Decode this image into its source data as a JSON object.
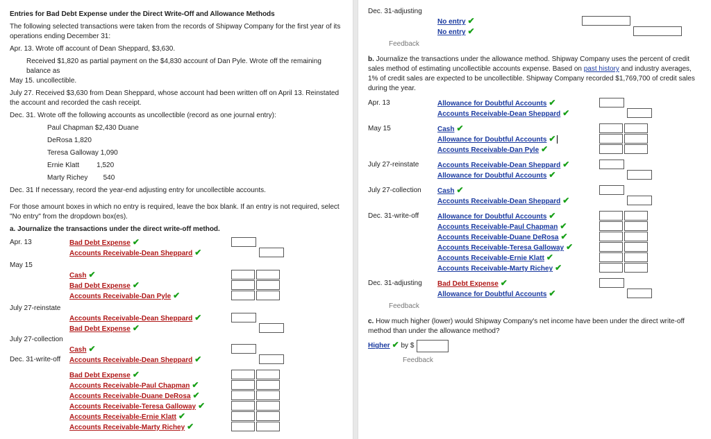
{
  "heading": "Entries for Bad Debt Expense under the Direct Write-Off and Allowance Methods",
  "intro": "The following selected transactions were taken from the records of Shipway Company for the first year of its operations ending December 31:",
  "tx": {
    "apr13": "Apr. 13. Wrote off account of Dean Sheppard, $3,630.",
    "may15a": "Received $1,820 as partial payment on the $4,830 account of Dan Pyle. Wrote off the remaining balance as",
    "may15b": "May 15. uncollectible.",
    "jul27": "July 27. Received $3,630 from Dean Sheppard, whose account had been written off on April 13. Reinstated the account and recorded the cash receipt.",
    "dec31": "Dec. 31. Wrote off the following accounts as uncollectible (record as one journal entry):",
    "list": {
      "a": "Paul Chapman $2,430 Duane",
      "b": "DeRosa 1,820",
      "c": "Teresa Galloway 1,090",
      "d": "Ernie Klatt         1,520",
      "e": "Marty Richey        540"
    },
    "dec31b": "Dec. 31 If necessary, record the year-end adjusting entry for uncollectible accounts."
  },
  "instr": "For those amount boxes in which no entry is required, leave the box blank. If an entry is not required, select \"No entry\" from the dropdown box(es).",
  "a_label": "a.  Journalize the transactions under the direct write-off method.",
  "accounts": {
    "bde": "Bad Debt Expense",
    "ar_shep": "Accounts Receivable-Dean Sheppard",
    "cash": "Cash",
    "ar_pyle": "Accounts Receivable-Dan Pyle",
    "ar_chap": "Accounts Receivable-Paul Chapman",
    "ar_derosa": "Accounts Receivable-Duane DeRosa",
    "ar_gallo": "Accounts Receivable-Teresa Galloway",
    "ar_klatt": "Accounts Receivable-Ernie Klatt",
    "ar_richey": "Accounts Receivable-Marty Richey",
    "ada": "Allowance for Doubtful Accounts",
    "noentry": "No entry"
  },
  "dates": {
    "apr13": "Apr. 13",
    "may15": "May 15",
    "jul27r": "July 27-reinstate",
    "jul27c": "July 27-collection",
    "dec31w": "Dec. 31-write-off",
    "dec31a": "Dec. 31-adjusting"
  },
  "feedback": "Feedback",
  "b_text": "Journalize the transactions under the allowance method. Shipway Company uses the percent of credit sales method of estimating uncollectible accounts expense. Based on ",
  "b_link": "past history",
  "b_text2": " and industry averages, 1% of credit sales are expected to be uncollectible. Shipway Company recorded $1,769,700 of credit sales during the year.",
  "c_text": "How much higher (lower) would Shipway Company's net income have been under the direct write-off method than under the allowance method?",
  "higher": "Higher",
  "by": " by $",
  "b_prefix": "b.  ",
  "c_prefix": "c.  "
}
